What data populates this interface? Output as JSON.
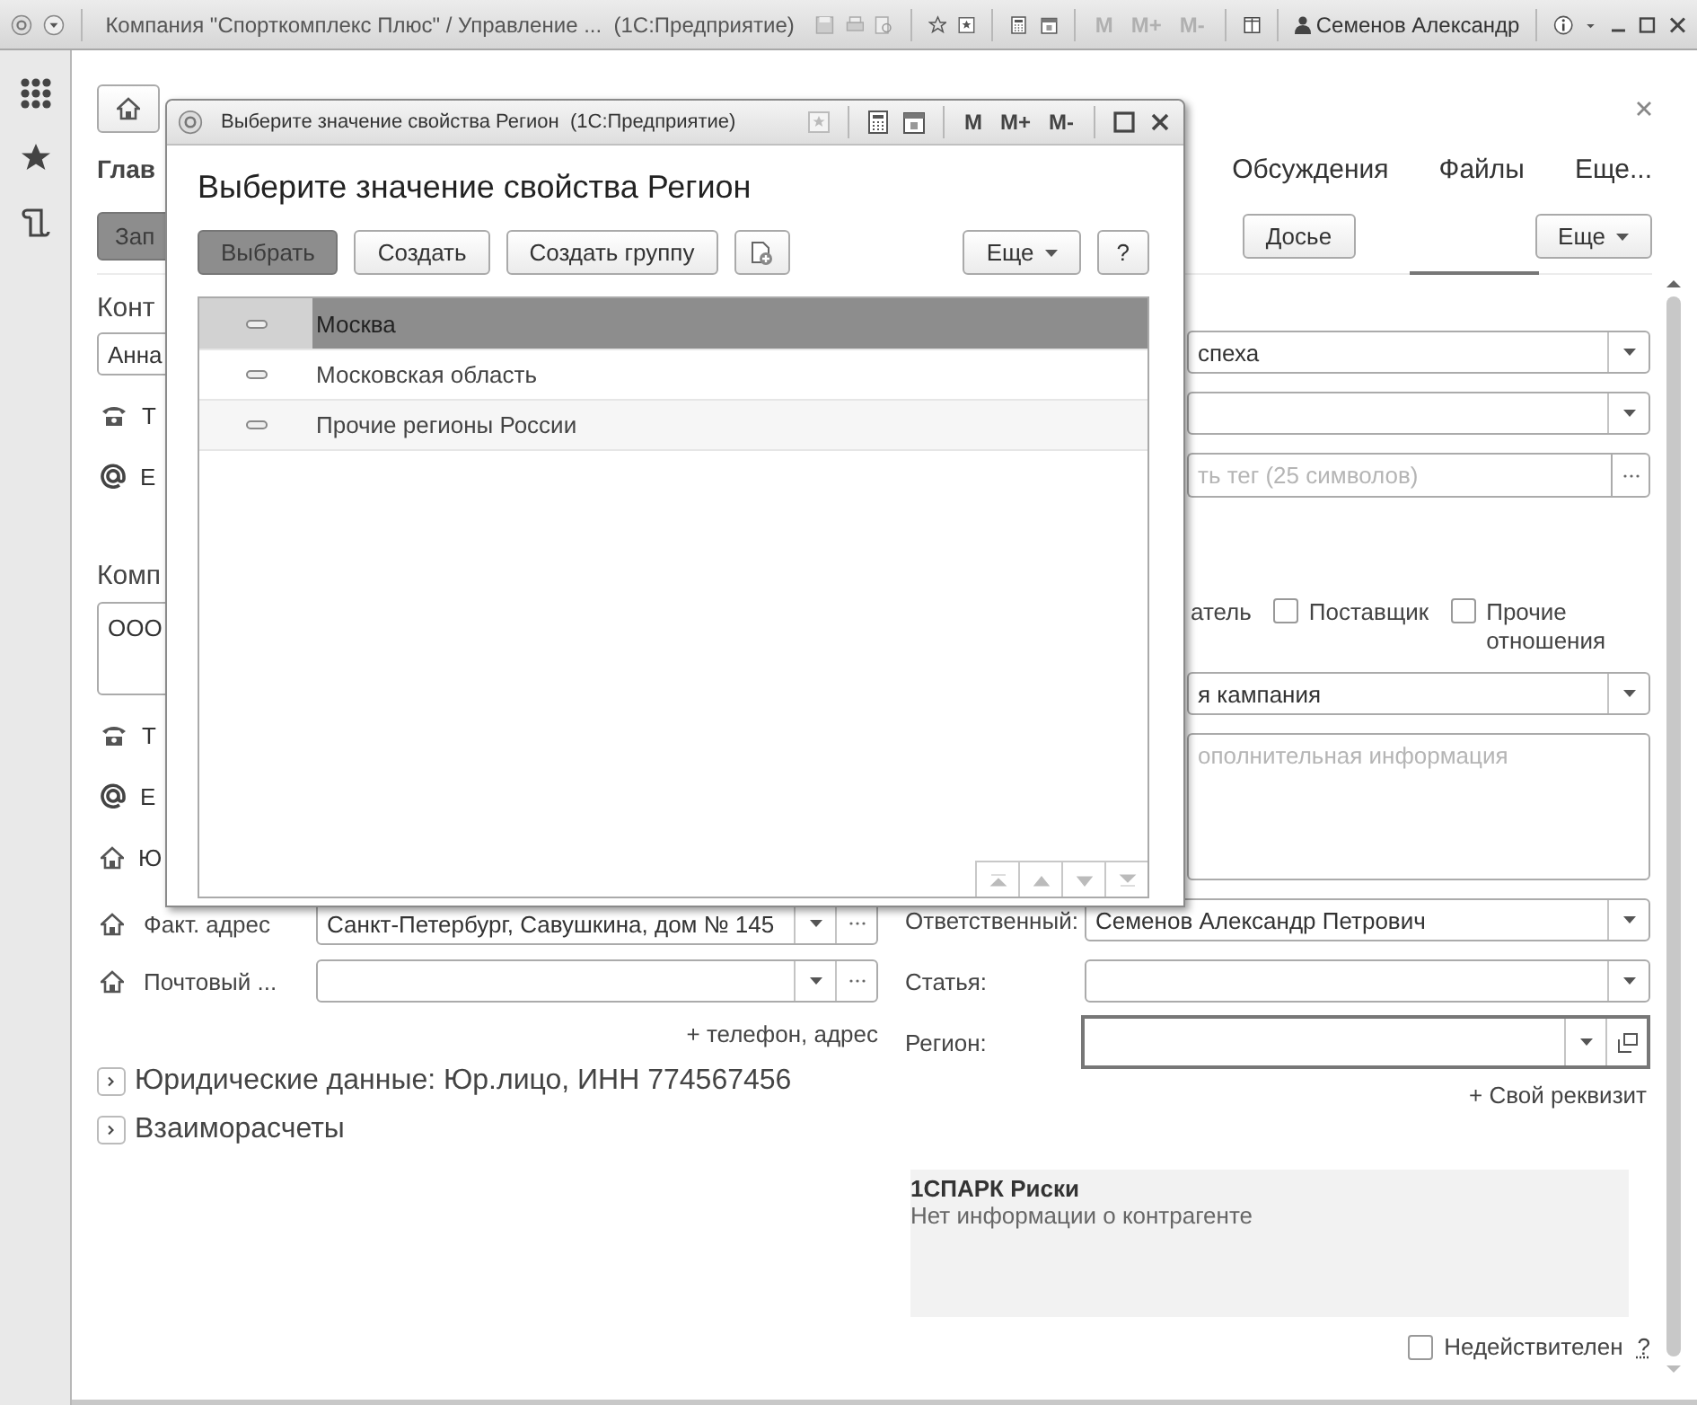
{
  "window": {
    "title": "Компания \"Спорткомплекс Плюс\" / Управление ...  (1С:Предприятие)",
    "memory_buttons": [
      {
        "label": "M",
        "disabled": true
      },
      {
        "label": "M+",
        "disabled": true
      },
      {
        "label": "M-",
        "disabled": true
      }
    ],
    "user": "Семенов Александр"
  },
  "form": {
    "title": "Глав",
    "tabs": [
      "Обсуждения",
      "Файлы",
      "Еще..."
    ],
    "primary_button": "Зап",
    "buttons": [
      "Досье"
    ],
    "more_button": "Еще",
    "left_rows": [
      {
        "kind": "caption",
        "text": "Конт"
      },
      {
        "kind": "input",
        "value": "Анна"
      },
      {
        "kind": "phone",
        "label": "Т"
      },
      {
        "kind": "email",
        "label": "Е"
      },
      {
        "kind": "caption",
        "text": "Комп"
      },
      {
        "kind": "memo",
        "value": "ООО"
      },
      {
        "kind": "phone",
        "label": "Т"
      },
      {
        "kind": "email",
        "label": "Е"
      },
      {
        "kind": "address",
        "label": "Ю"
      },
      {
        "kind": "address_field",
        "label": "Факт. адрес",
        "value": "Санкт-Петербург, Савушкина, дом № 145"
      },
      {
        "kind": "address_field",
        "label": "Почтовый ..."
      },
      {
        "kind": "link",
        "text": "+ телефон, адрес"
      }
    ],
    "sections": [
      {
        "label": "Юридические данные: Юр.лицо, ИНН 774567456",
        "expanded": false
      },
      {
        "label": "Взаиморасчеты",
        "expanded": false
      }
    ],
    "right_rows": [
      {
        "kind": "select",
        "value": "спеха"
      },
      {
        "kind": "select"
      },
      {
        "kind": "tag",
        "placeholder": "ть тег (25 символов)"
      },
      {
        "kind": "checks",
        "fragment": "атель",
        "items": [
          {
            "label": "Поставщик",
            "checked": false
          },
          {
            "label": "Прочие отношения",
            "checked": false
          }
        ]
      },
      {
        "kind": "select",
        "value": "я кампания"
      },
      {
        "kind": "memo",
        "placeholder": "ополнительная информация"
      },
      {
        "kind": "labeled_select",
        "label": "Ответственный:",
        "value": "Семенов Александр Петрович"
      },
      {
        "kind": "labeled_select",
        "label": "Статья:"
      },
      {
        "kind": "choice",
        "label": "Регион:",
        "focused": true
      },
      {
        "kind": "link",
        "text": "+ Свой реквизит"
      }
    ],
    "spark": {
      "title": "1СПАРК Риски",
      "text": "Нет информации о контрагенте"
    },
    "inactive": {
      "label": "Недействителен",
      "checked": false,
      "help": "?"
    }
  },
  "dialog": {
    "title": "Выберите значение свойства Регион  (1С:Предприятие)",
    "memory_buttons": [
      {
        "label": "M",
        "disabled": false
      },
      {
        "label": "M+",
        "disabled": false
      },
      {
        "label": "M-",
        "disabled": false
      }
    ],
    "heading": "Выберите значение свойства Регион",
    "buttons": [
      {
        "kind": "default",
        "label": "Выбрать"
      },
      {
        "kind": "normal",
        "label": "Создать"
      },
      {
        "kind": "normal",
        "label": "Создать группу"
      },
      {
        "kind": "icon"
      }
    ],
    "more_button": "Еще",
    "help_button": "?",
    "items": [
      {
        "label": "Москва",
        "selected": true
      },
      {
        "label": "Московская область",
        "selected": false
      },
      {
        "label": "Прочие регионы России",
        "selected": false
      }
    ]
  }
}
